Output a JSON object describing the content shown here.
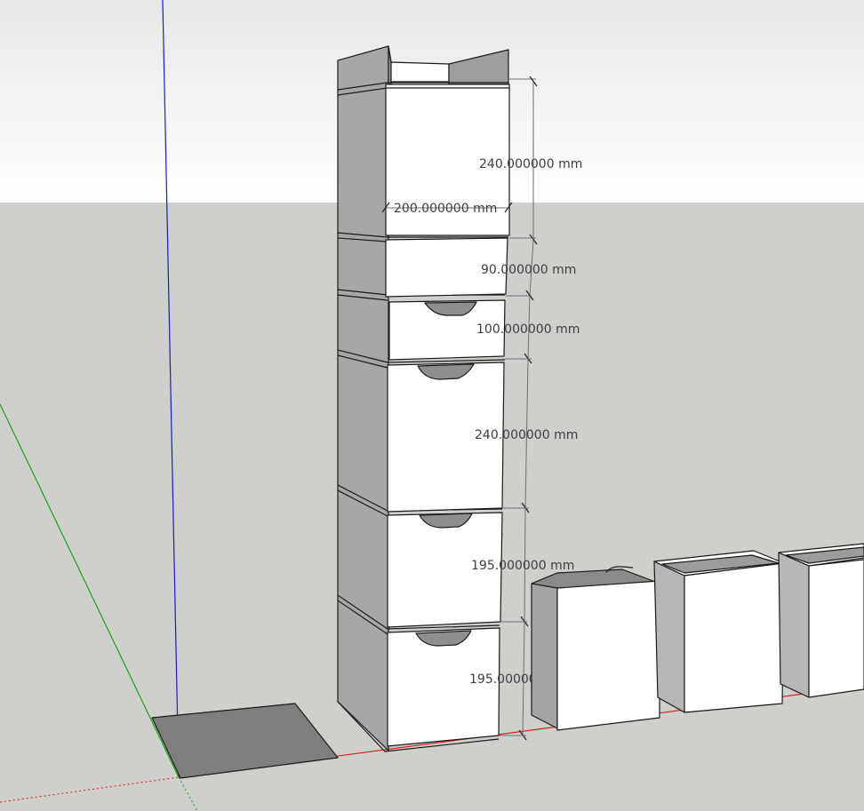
{
  "app": {
    "view": "3D model viewport"
  },
  "colors": {
    "sky_top": "#e9ebeb",
    "sky_bottom": "#ffffff",
    "ground": "#cfcfcb",
    "face_light": "#ffffff",
    "face_dark": "#a9a9a9",
    "face_mid": "#c4c4c4",
    "axis_blue": "#1c1ccf",
    "axis_green": "#1e9e1e",
    "axis_red": "#d42020",
    "dimension_text": "#3d3d3d"
  },
  "dimensions": {
    "top_drawer_height": "240.000000 mm",
    "top_drawer_width": "200.000000 mm",
    "spacer_height": "90.000000 mm",
    "drawer_2_height": "100.000000 mm",
    "drawer_3_height": "240.000000 mm",
    "drawer_4_height": "195.000000 mm",
    "drawer_5_height": "195.000000 mm"
  },
  "icons": {
    "axis_origin": "axis-origin-icon"
  }
}
